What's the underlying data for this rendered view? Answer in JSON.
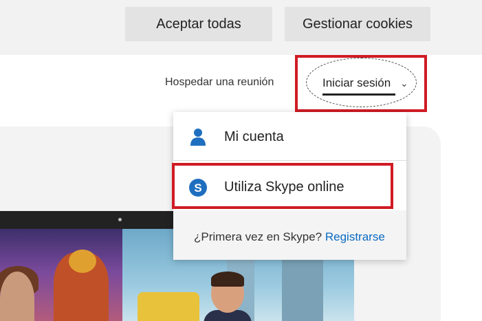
{
  "cookie_bar": {
    "accept_label": "Aceptar todas",
    "manage_label": "Gestionar cookies"
  },
  "header": {
    "host_meeting_label": "Hospedar una reunión",
    "sign_in_label": "Iniciar sesión",
    "chevron_icon": "chevron-down-icon"
  },
  "dropdown": {
    "items": [
      {
        "label": "Mi cuenta",
        "icon": "person-icon",
        "icon_color": "#1f6fc0"
      },
      {
        "label": "Utiliza Skype online",
        "icon": "skype-icon",
        "icon_color": "#1f6fc0"
      }
    ],
    "footer_prompt": "¿Primera vez en Skype?",
    "footer_link": "Registrarse"
  },
  "colors": {
    "highlight_red": "#d01b24",
    "link_blue": "#0a6ac3",
    "skype_blue": "#1f6fc0"
  }
}
